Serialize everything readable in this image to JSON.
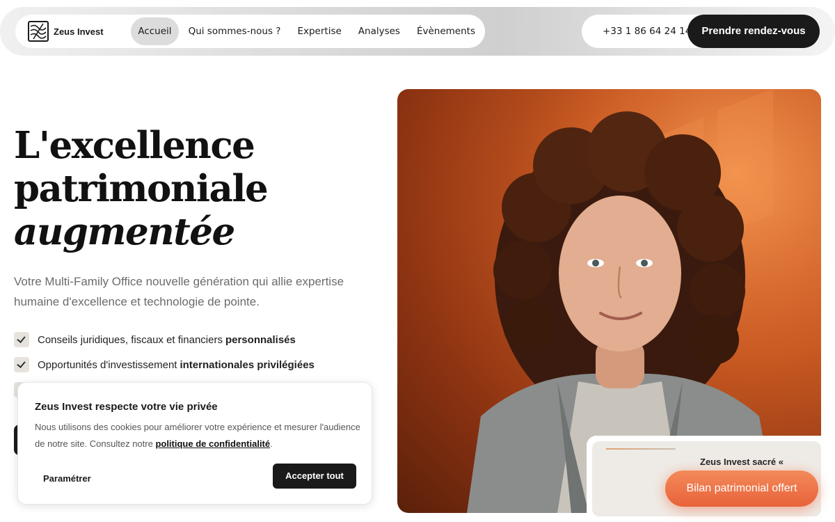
{
  "header": {
    "logo_text": "Zeus Invest",
    "nav": [
      {
        "label": "Accueil",
        "active": true
      },
      {
        "label": "Qui sommes-nous ?"
      },
      {
        "label": "Expertise"
      },
      {
        "label": "Analyses"
      },
      {
        "label": "Évènements"
      }
    ],
    "phone": "+33 1 86 64 24 14",
    "cta_label": "Prendre rendez-vous"
  },
  "hero": {
    "title_line1": "L'excellence",
    "title_line2": "patrimoniale",
    "title_line3": "augmentée",
    "subtitle": "Votre Multi-Family Office nouvelle génération qui allie expertise humaine d'excellence et technologie de pointe.",
    "checks": [
      {
        "text": "Conseils juridiques, fiscaux et financiers",
        "bold": "personnalisés"
      },
      {
        "text": "Opportunités d'investissement",
        "bold": "internationales privilégiées"
      }
    ]
  },
  "review": {
    "text": "Zeus Invest sacré «",
    "bilan_label": "Bilan patrimonial offert"
  },
  "cookie": {
    "title": "Zeus Invest respecte votre vie privée",
    "body_start": "Nous utilisons des cookies pour améliorer votre expérience et mesurer l'audience de notre site. Consultez notre ",
    "policy_link": "politique de confidentialité",
    "body_end": ".",
    "settings_label": "Paramétrer",
    "accept_label": "Accepter tout"
  },
  "colors": {
    "dark": "#1a1a1a",
    "accent": "#e8623a",
    "photo_bg": "#c95a22"
  }
}
